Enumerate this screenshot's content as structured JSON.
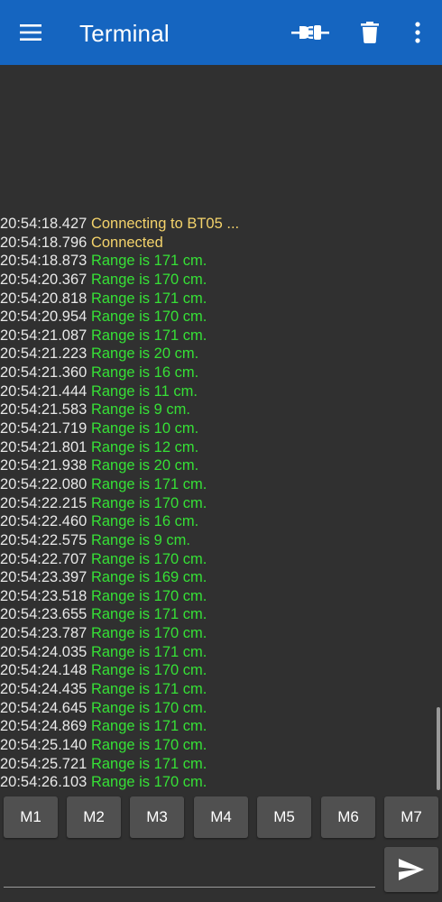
{
  "app_bar": {
    "title": "Terminal",
    "background_color": "#1565c0",
    "icons": [
      "menu-icon",
      "plug-connect-icon",
      "trash-icon",
      "more-vert-icon"
    ]
  },
  "terminal": {
    "background_color": "#303030",
    "status_color": "#f4d36b",
    "data_color": "#36e036",
    "lines": [
      {
        "time": "20:54:18.427",
        "text": "Connecting to BT05 ...",
        "kind": "status"
      },
      {
        "time": "20:54:18.796",
        "text": "Connected",
        "kind": "status"
      },
      {
        "time": "20:54:18.873",
        "text": "Range is 171 cm.",
        "kind": "data"
      },
      {
        "time": "20:54:20.367",
        "text": "Range is 170 cm.",
        "kind": "data"
      },
      {
        "time": "20:54:20.818",
        "text": "Range is 171 cm.",
        "kind": "data"
      },
      {
        "time": "20:54:20.954",
        "text": "Range is 170 cm.",
        "kind": "data"
      },
      {
        "time": "20:54:21.087",
        "text": "Range is 171 cm.",
        "kind": "data"
      },
      {
        "time": "20:54:21.223",
        "text": "Range is 20 cm.",
        "kind": "data"
      },
      {
        "time": "20:54:21.360",
        "text": "Range is 16 cm.",
        "kind": "data"
      },
      {
        "time": "20:54:21.444",
        "text": "Range is 11 cm.",
        "kind": "data"
      },
      {
        "time": "20:54:21.583",
        "text": "Range is 9 cm.",
        "kind": "data"
      },
      {
        "time": "20:54:21.719",
        "text": "Range is 10 cm.",
        "kind": "data"
      },
      {
        "time": "20:54:21.801",
        "text": "Range is 12 cm.",
        "kind": "data"
      },
      {
        "time": "20:54:21.938",
        "text": "Range is 20 cm.",
        "kind": "data"
      },
      {
        "time": "20:54:22.080",
        "text": "Range is 171 cm.",
        "kind": "data"
      },
      {
        "time": "20:54:22.215",
        "text": "Range is 170 cm.",
        "kind": "data"
      },
      {
        "time": "20:54:22.460",
        "text": "Range is 16 cm.",
        "kind": "data"
      },
      {
        "time": "20:54:22.575",
        "text": "Range is 9 cm.",
        "kind": "data"
      },
      {
        "time": "20:54:22.707",
        "text": "Range is 170 cm.",
        "kind": "data"
      },
      {
        "time": "20:54:23.397",
        "text": "Range is 169 cm.",
        "kind": "data"
      },
      {
        "time": "20:54:23.518",
        "text": "Range is 170 cm.",
        "kind": "data"
      },
      {
        "time": "20:54:23.655",
        "text": "Range is 171 cm.",
        "kind": "data"
      },
      {
        "time": "20:54:23.787",
        "text": "Range is 170 cm.",
        "kind": "data"
      },
      {
        "time": "20:54:24.035",
        "text": "Range is 171 cm.",
        "kind": "data"
      },
      {
        "time": "20:54:24.148",
        "text": "Range is 170 cm.",
        "kind": "data"
      },
      {
        "time": "20:54:24.435",
        "text": "Range is 171 cm.",
        "kind": "data"
      },
      {
        "time": "20:54:24.645",
        "text": "Range is 170 cm.",
        "kind": "data"
      },
      {
        "time": "20:54:24.869",
        "text": "Range is 171 cm.",
        "kind": "data"
      },
      {
        "time": "20:54:25.140",
        "text": "Range is 170 cm.",
        "kind": "data"
      },
      {
        "time": "20:54:25.721",
        "text": "Range is 171 cm.",
        "kind": "data"
      },
      {
        "time": "20:54:26.103",
        "text": "Range is 170 cm.",
        "kind": "data"
      }
    ]
  },
  "macros": {
    "buttons": [
      {
        "label": "M1"
      },
      {
        "label": "M2"
      },
      {
        "label": "M3"
      },
      {
        "label": "M4"
      },
      {
        "label": "M5"
      },
      {
        "label": "M6"
      },
      {
        "label": "M7"
      }
    ]
  },
  "input": {
    "value": "",
    "placeholder": "",
    "send_icon": "send-icon"
  }
}
